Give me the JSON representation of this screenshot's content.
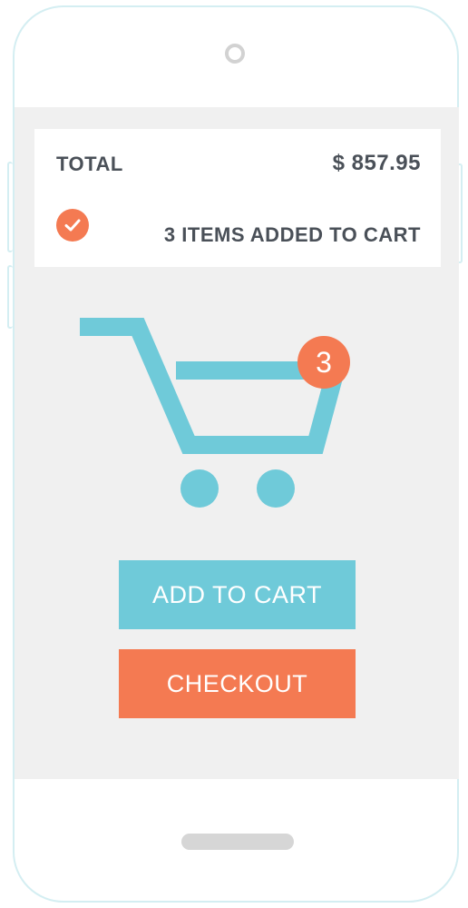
{
  "summary": {
    "total_label": "TOTAL",
    "total_value": "$ 857.95",
    "status_text": "3 ITEMS ADDED TO CART"
  },
  "cart": {
    "badge_count": "3"
  },
  "actions": {
    "add_to_cart_label": "ADD TO CART",
    "checkout_label": "CHECKOUT"
  },
  "colors": {
    "accent_blue": "#6fcad9",
    "accent_orange": "#f47a52",
    "screen_bg": "#f0f0f0",
    "text_dark": "#4a5058"
  },
  "icons": {
    "status": "checkmark-icon",
    "cart": "shopping-cart-icon"
  }
}
